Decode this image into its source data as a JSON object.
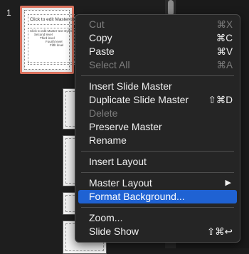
{
  "slide_number": "1",
  "thumbnail": {
    "title": "Click to edit Master title style",
    "body_lines": [
      "Click to edit Master text styles",
      "Second level",
      "Third level",
      "Fourth level",
      "Fifth level"
    ]
  },
  "menu": {
    "cut": {
      "label": "Cut",
      "shortcut": "⌘X"
    },
    "copy": {
      "label": "Copy",
      "shortcut": "⌘C"
    },
    "paste": {
      "label": "Paste",
      "shortcut": "⌘V"
    },
    "select_all": {
      "label": "Select All",
      "shortcut": "⌘A"
    },
    "insert_slide_master": {
      "label": "Insert Slide Master"
    },
    "duplicate_slide_master": {
      "label": "Duplicate Slide Master",
      "shortcut": "⇧⌘D"
    },
    "delete": {
      "label": "Delete"
    },
    "preserve_master": {
      "label": "Preserve Master"
    },
    "rename": {
      "label": "Rename"
    },
    "insert_layout": {
      "label": "Insert Layout"
    },
    "master_layout": {
      "label": "Master Layout",
      "arrow": "▶"
    },
    "format_background": {
      "label": "Format Background..."
    },
    "zoom": {
      "label": "Zoom..."
    },
    "slide_show": {
      "label": "Slide Show",
      "shortcut": "⇧⌘↩"
    }
  },
  "colors": {
    "selection_border": "#d9725e",
    "menu_highlight": "#1f62d3",
    "menu_background": "#252525"
  }
}
